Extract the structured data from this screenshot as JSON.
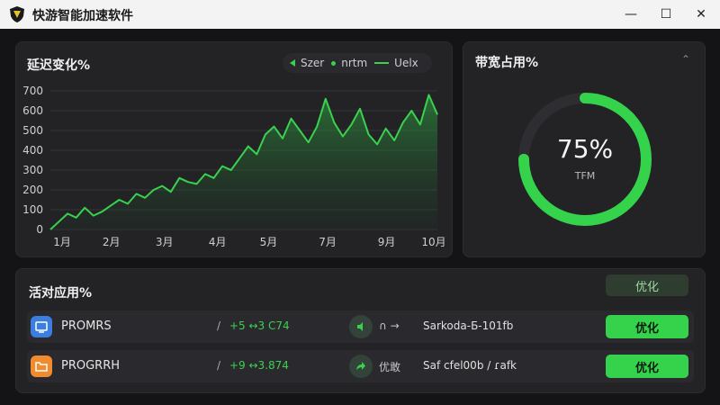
{
  "window": {
    "title": "快游智能加速软件",
    "min_glyph": "—",
    "max_glyph": "☐",
    "close_glyph": "✕"
  },
  "chart_panel": {
    "title": "延迟变化%",
    "legend": [
      "Szer",
      "nrtm",
      "Uelx"
    ]
  },
  "chart_data": {
    "type": "area",
    "title": "延迟变化%",
    "xlabel": "",
    "ylabel": "",
    "ylim": [
      0,
      700
    ],
    "yticks": [
      0,
      100,
      200,
      300,
      400,
      500,
      600,
      700
    ],
    "xticks": [
      "1月",
      "2月",
      "3月",
      "4月",
      "5月",
      "7月",
      "9月",
      "10月"
    ],
    "grid": "horizontal",
    "series": [
      {
        "name": "Uelx",
        "x": [
          1.0,
          1.2,
          1.4,
          1.6,
          1.8,
          2.0,
          2.2,
          2.4,
          2.6,
          2.8,
          3.0,
          3.2,
          3.4,
          3.6,
          3.8,
          4.0,
          4.2,
          4.4,
          4.6,
          4.8,
          5.0,
          5.2,
          5.4,
          5.6,
          5.8,
          6.0,
          6.2,
          6.4,
          6.6,
          6.8,
          7.0,
          7.2,
          7.4,
          7.6,
          7.8,
          8.0,
          8.2,
          8.4,
          8.6,
          8.8,
          9.0,
          9.2,
          9.4,
          9.6,
          9.8,
          10.0
        ],
        "values": [
          0,
          40,
          80,
          60,
          110,
          70,
          90,
          120,
          150,
          130,
          180,
          160,
          200,
          220,
          190,
          260,
          240,
          230,
          280,
          260,
          320,
          300,
          360,
          420,
          380,
          480,
          520,
          460,
          560,
          500,
          440,
          520,
          660,
          540,
          470,
          530,
          610,
          480,
          430,
          510,
          450,
          540,
          600,
          530,
          680,
          580
        ]
      }
    ]
  },
  "bandwidth_panel": {
    "title": "带宽占用%",
    "value_label": "75%",
    "value": 0.75,
    "unit_label": "TFM",
    "collapse_glyph": "⌃"
  },
  "apps_panel": {
    "title": "活对应用%",
    "optimize_all_label": "优化",
    "rows": [
      {
        "name": "PROMRS",
        "slash": "/",
        "speed": "+5 ↔3 C74",
        "action_label": "∩ →",
        "server": "Sarkoda-Б-101fb",
        "button_label": "优化",
        "icon_color": "#3b7ee0",
        "action_icon": "speaker-icon"
      },
      {
        "name": "PROGRRH",
        "slash": "/",
        "speed": "+9 ↔3.874",
        "action_label": "优敢",
        "server": "Saf cfel00b / ɾafk",
        "button_label": "优化",
        "icon_color": "#f08c2e",
        "action_icon": "forward-arrow-icon"
      }
    ]
  },
  "colors": {
    "accent": "#34d34b",
    "background": "#141416",
    "card": "#232326"
  }
}
